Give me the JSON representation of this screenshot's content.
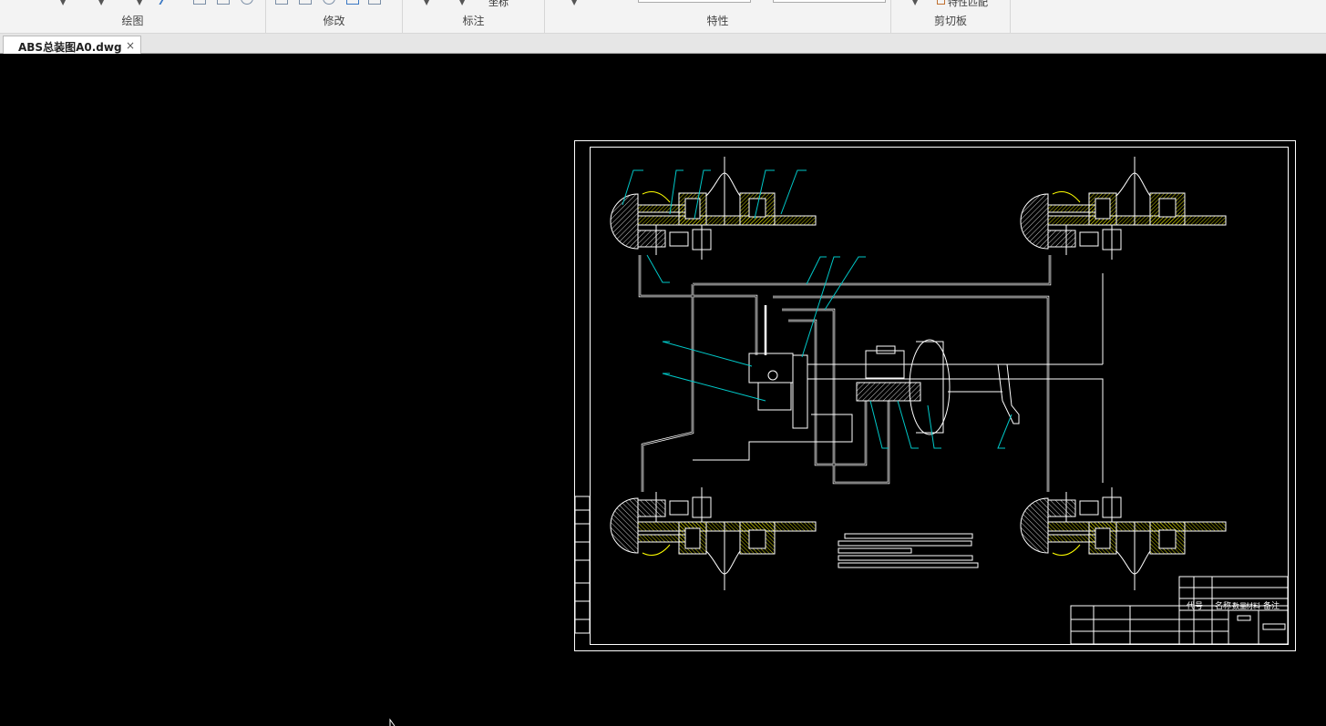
{
  "ribbon": {
    "groups": [
      {
        "label": "绘图"
      },
      {
        "label": "修改"
      },
      {
        "label": "标注"
      },
      {
        "label": "特性"
      },
      {
        "label": "剪切板"
      }
    ],
    "dim_partial_label": "坐标",
    "clipboard_partial_label": "特性匹配"
  },
  "tabs": [
    {
      "label": "ABS总装图A0.dwg",
      "close": "×"
    }
  ],
  "drawing": {
    "colors": {
      "background": "#000000",
      "lines": "#ffffff",
      "leaders": "#00c8c8",
      "hatch": "#ffff00"
    },
    "title_block_headers": [
      "代号",
      "名称",
      "数量",
      "材料",
      "备注"
    ]
  }
}
